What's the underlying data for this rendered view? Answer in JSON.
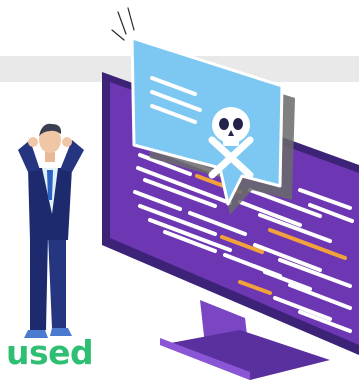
{
  "caption": {
    "text": "used"
  },
  "colors": {
    "accent": "#2fbf72",
    "monitor_frame": "#4a2a8a",
    "monitor_screen": "#6d37b3",
    "code_lines": "#ffffff",
    "code_highlight": "#f2a23a",
    "alert_bubble": "#7cc8f2",
    "suit": "#1e2a6e"
  },
  "icons": {
    "alert": "skull-crossbones-icon",
    "person": "confused-man-illustration"
  }
}
